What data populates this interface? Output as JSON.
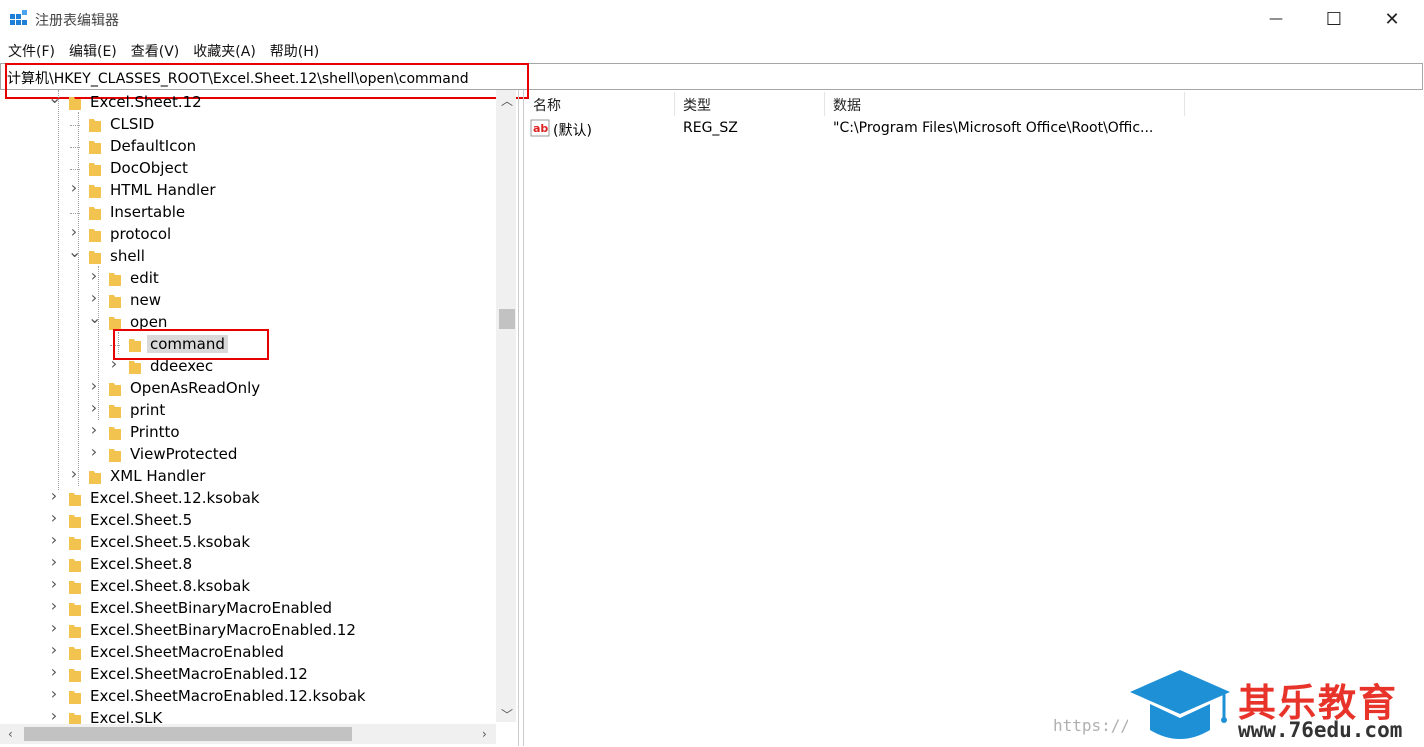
{
  "window": {
    "title": "注册表编辑器",
    "minimize": "—",
    "maximize": "☐",
    "close": "✕"
  },
  "menu": [
    "文件(F)",
    "编辑(E)",
    "查看(V)",
    "收藏夹(A)",
    "帮助(H)"
  ],
  "address": "计算机\\HKEY_CLASSES_ROOT\\Excel.Sheet.12\\shell\\open\\command",
  "tree": [
    {
      "label": "Excel.Sheet.12",
      "chevron": "down"
    },
    {
      "label": "CLSID",
      "chevron": "none"
    },
    {
      "label": "DefaultIcon",
      "chevron": "none"
    },
    {
      "label": "DocObject",
      "chevron": "none"
    },
    {
      "label": "HTML Handler",
      "chevron": "right"
    },
    {
      "label": "Insertable",
      "chevron": "none"
    },
    {
      "label": "protocol",
      "chevron": "right"
    },
    {
      "label": "shell",
      "chevron": "down"
    },
    {
      "label": "edit",
      "chevron": "right"
    },
    {
      "label": "new",
      "chevron": "right"
    },
    {
      "label": "open",
      "chevron": "down"
    },
    {
      "label": "command",
      "chevron": "none",
      "selected": true
    },
    {
      "label": "ddeexec",
      "chevron": "right"
    },
    {
      "label": "OpenAsReadOnly",
      "chevron": "right"
    },
    {
      "label": "print",
      "chevron": "right"
    },
    {
      "label": "Printto",
      "chevron": "right"
    },
    {
      "label": "ViewProtected",
      "chevron": "right"
    },
    {
      "label": "XML Handler",
      "chevron": "right"
    },
    {
      "label": "Excel.Sheet.12.ksobak",
      "chevron": "right"
    },
    {
      "label": "Excel.Sheet.5",
      "chevron": "right"
    },
    {
      "label": "Excel.Sheet.5.ksobak",
      "chevron": "right"
    },
    {
      "label": "Excel.Sheet.8",
      "chevron": "right"
    },
    {
      "label": "Excel.Sheet.8.ksobak",
      "chevron": "right"
    },
    {
      "label": "Excel.SheetBinaryMacroEnabled",
      "chevron": "right"
    },
    {
      "label": "Excel.SheetBinaryMacroEnabled.12",
      "chevron": "right"
    },
    {
      "label": "Excel.SheetMacroEnabled",
      "chevron": "right"
    },
    {
      "label": "Excel.SheetMacroEnabled.12",
      "chevron": "right"
    },
    {
      "label": "Excel.SheetMacroEnabled.12.ksobak",
      "chevron": "right"
    },
    {
      "label": "Excel.SLK",
      "chevron": "right"
    }
  ],
  "columns": {
    "name": "名称",
    "type": "类型",
    "data": "数据"
  },
  "values": [
    {
      "name": "(默认)",
      "type": "REG_SZ",
      "data": "\"C:\\Program Files\\Microsoft Office\\Root\\Offic..."
    }
  ],
  "watermark": {
    "url": "https://",
    "brand_cn": "其乐教育",
    "brand_url": "www.76edu.com"
  },
  "colors": {
    "highlight_box": "#e60000",
    "folder": "#f2c34e",
    "brand_red": "#e8332a",
    "brand_blue": "#1e90d6"
  }
}
